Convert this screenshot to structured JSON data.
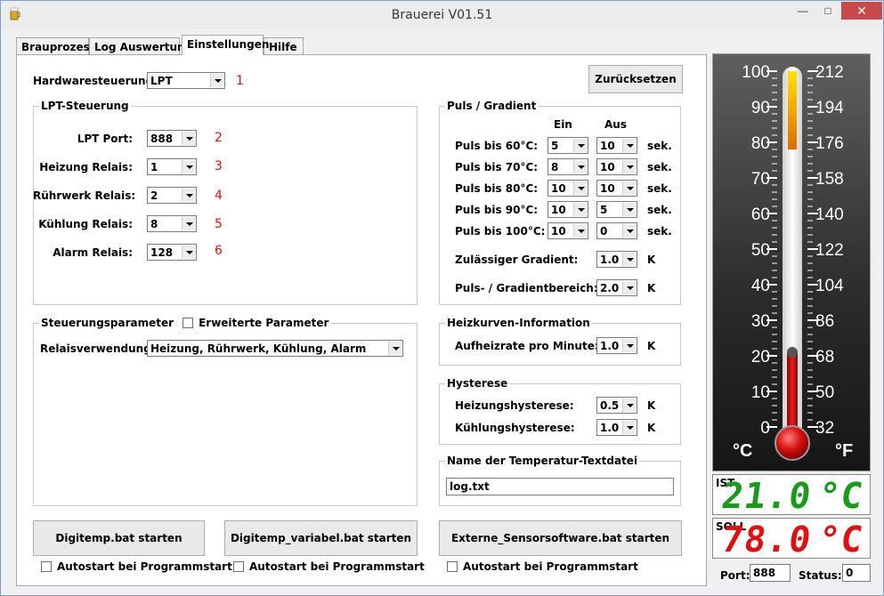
{
  "window": {
    "title": "Brauerei V01.51"
  },
  "tabs": [
    {
      "label": "Brauprozess"
    },
    {
      "label": "Log Auswertung"
    },
    {
      "label": "Einstellungen"
    },
    {
      "label": "Hilfe"
    }
  ],
  "hardware": {
    "label": "Hardwaresteuerung:",
    "value": "LPT",
    "marker": "1"
  },
  "reset_button": "Zurücksetzen",
  "lpt": {
    "title": "LPT-Steuerung",
    "rows": [
      {
        "label": "LPT Port:",
        "value": "888",
        "marker": "2"
      },
      {
        "label": "Heizung Relais:",
        "value": "1",
        "marker": "3"
      },
      {
        "label": "Rührwerk Relais:",
        "value": "2",
        "marker": "4"
      },
      {
        "label": "Kühlung Relais:",
        "value": "8",
        "marker": "5"
      },
      {
        "label": "Alarm Relais:",
        "value": "128",
        "marker": "6"
      }
    ]
  },
  "puls": {
    "title": "Puls / Gradient",
    "col_on": "Ein",
    "col_off": "Aus",
    "unit": "sek.",
    "rows": [
      {
        "label": "Puls bis 60°C:",
        "on": "5",
        "off": "10"
      },
      {
        "label": "Puls bis 70°C:",
        "on": "8",
        "off": "10"
      },
      {
        "label": "Puls bis 80°C:",
        "on": "10",
        "off": "10"
      },
      {
        "label": "Puls bis 90°C:",
        "on": "10",
        "off": "5"
      },
      {
        "label": "Puls bis 100°C:",
        "on": "10",
        "off": "0"
      }
    ],
    "gradient": {
      "label": "Zulässiger Gradient:",
      "value": "1.0",
      "unit": "K"
    },
    "range": {
      "label": "Puls- / Gradientbereich:",
      "value": "2.0",
      "unit": "K"
    }
  },
  "steuerung": {
    "title": "Steuerungsparameter",
    "extended_label": "Erweiterte Parameter",
    "relay_label": "Relaisverwendung:",
    "relay_value": "Heizung, Rührwerk, Kühlung, Alarm"
  },
  "heizkurve": {
    "title": "Heizkurven-Information",
    "label": "Aufheizrate pro Minute:",
    "value": "1.0",
    "unit": "K"
  },
  "hysterese": {
    "title": "Hysterese",
    "heat_label": "Heizungshysterese:",
    "heat_value": "0.5",
    "cool_label": "Kühlungshysterese:",
    "cool_value": "1.0",
    "unit": "K"
  },
  "textfile": {
    "title": "Name der Temperatur-Textdatei",
    "value": "log.txt"
  },
  "bat_buttons": [
    {
      "label": "Digitemp.bat starten",
      "autostart": "Autostart bei Programmstart"
    },
    {
      "label": "Digitemp_variabel.bat starten",
      "autostart": "Autostart bei Programmstart"
    },
    {
      "label": "Externe_Sensorsoftware.bat starten",
      "autostart": "Autostart bei Programmstart"
    }
  ],
  "thermometer": {
    "celsius_ticks": [
      "100",
      "90",
      "80",
      "70",
      "60",
      "50",
      "40",
      "30",
      "20",
      "10",
      "0"
    ],
    "fahrenheit_ticks": [
      "212",
      "194",
      "176",
      "158",
      "140",
      "122",
      "104",
      "86",
      "68",
      "50",
      "32"
    ],
    "unit_c": "°C",
    "unit_f": "°F",
    "current_c": 21.0,
    "target_c": 78.0
  },
  "ist": {
    "label": "IST",
    "value": "21.0",
    "unit": "°C",
    "color": "#1a9a1a"
  },
  "soll": {
    "label": "SOLL",
    "value": "78.0",
    "unit": "°C",
    "color": "#e01010"
  },
  "status_bar": {
    "port_label": "Port:",
    "port_value": "888",
    "status_label": "Status:",
    "status_value": "0"
  }
}
